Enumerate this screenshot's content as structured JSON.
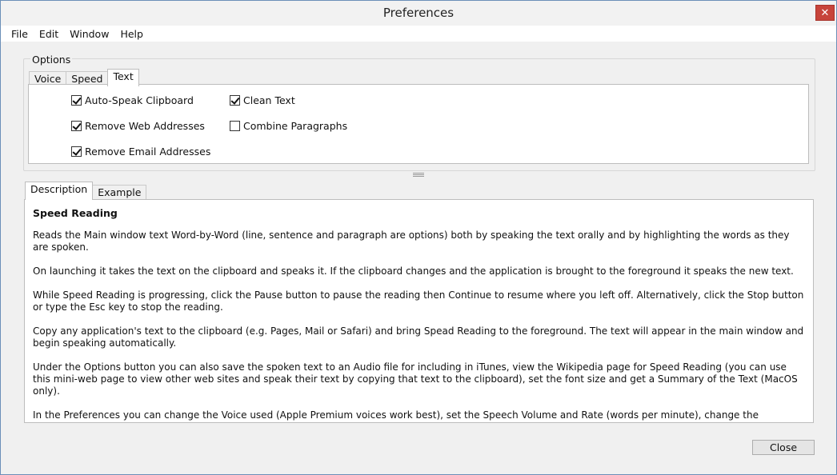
{
  "window": {
    "title": "Preferences",
    "close_glyph": "✕"
  },
  "menu": {
    "items": [
      "File",
      "Edit",
      "Window",
      "Help"
    ]
  },
  "options": {
    "group_title": "Options",
    "tabs": [
      "Voice",
      "Speed",
      "Text"
    ],
    "active_tab": "Text",
    "checkboxes": {
      "auto_speak": {
        "label": "Auto-Speak Clipboard",
        "checked": true
      },
      "clean_text": {
        "label": "Clean Text",
        "checked": true
      },
      "remove_web": {
        "label": "Remove Web Addresses",
        "checked": true
      },
      "combine_paragraphs": {
        "label": "Combine Paragraphs",
        "checked": false
      },
      "remove_email": {
        "label": "Remove Email Addresses",
        "checked": true
      }
    }
  },
  "description": {
    "tabs": [
      "Description",
      "Example"
    ],
    "active_tab": "Description",
    "heading": "Speed Reading",
    "paragraphs": [
      "Reads the Main window text Word-by-Word (line, sentence and paragraph are options) both by speaking the text orally and by highlighting the words as they are spoken.",
      "On launching it takes the text on the clipboard and speaks it. If the clipboard changes and the application is brought to the foreground it speaks the new text.",
      "While Speed Reading is progressing, click the Pause button to pause the reading then Continue to resume where you left off. Alternatively, click the Stop button or type the Esc key to stop the reading.",
      "Copy any application's text to the clipboard (e.g. Pages, Mail or Safari) and bring Spead Reading to the foreground. The text will appear in the main window and begin speaking automatically.",
      "Under the Options button you can also save the spoken text to an Audio file for including in iTunes, view the Wikipedia page for Speed Reading (you can use this mini-web page to view other web sites and speak their text by copying that text to the clipboard), set the font size and get a Summary of the Text (MacOS only).",
      "In the Preferences you can change the Voice used (Apple Premium voices work best), set the Speech Volume and Rate (words per minute), change the highlighting to Word/Line/Sentence/Paragraph, turn on/off the automatic reading of the clipboard, turn on/off the removal of web addresses and email, clean the text and combine the paragraphs (some PDFs and email packages treat each line as a new paragraph)."
    ]
  },
  "footer": {
    "close_label": "Close"
  }
}
